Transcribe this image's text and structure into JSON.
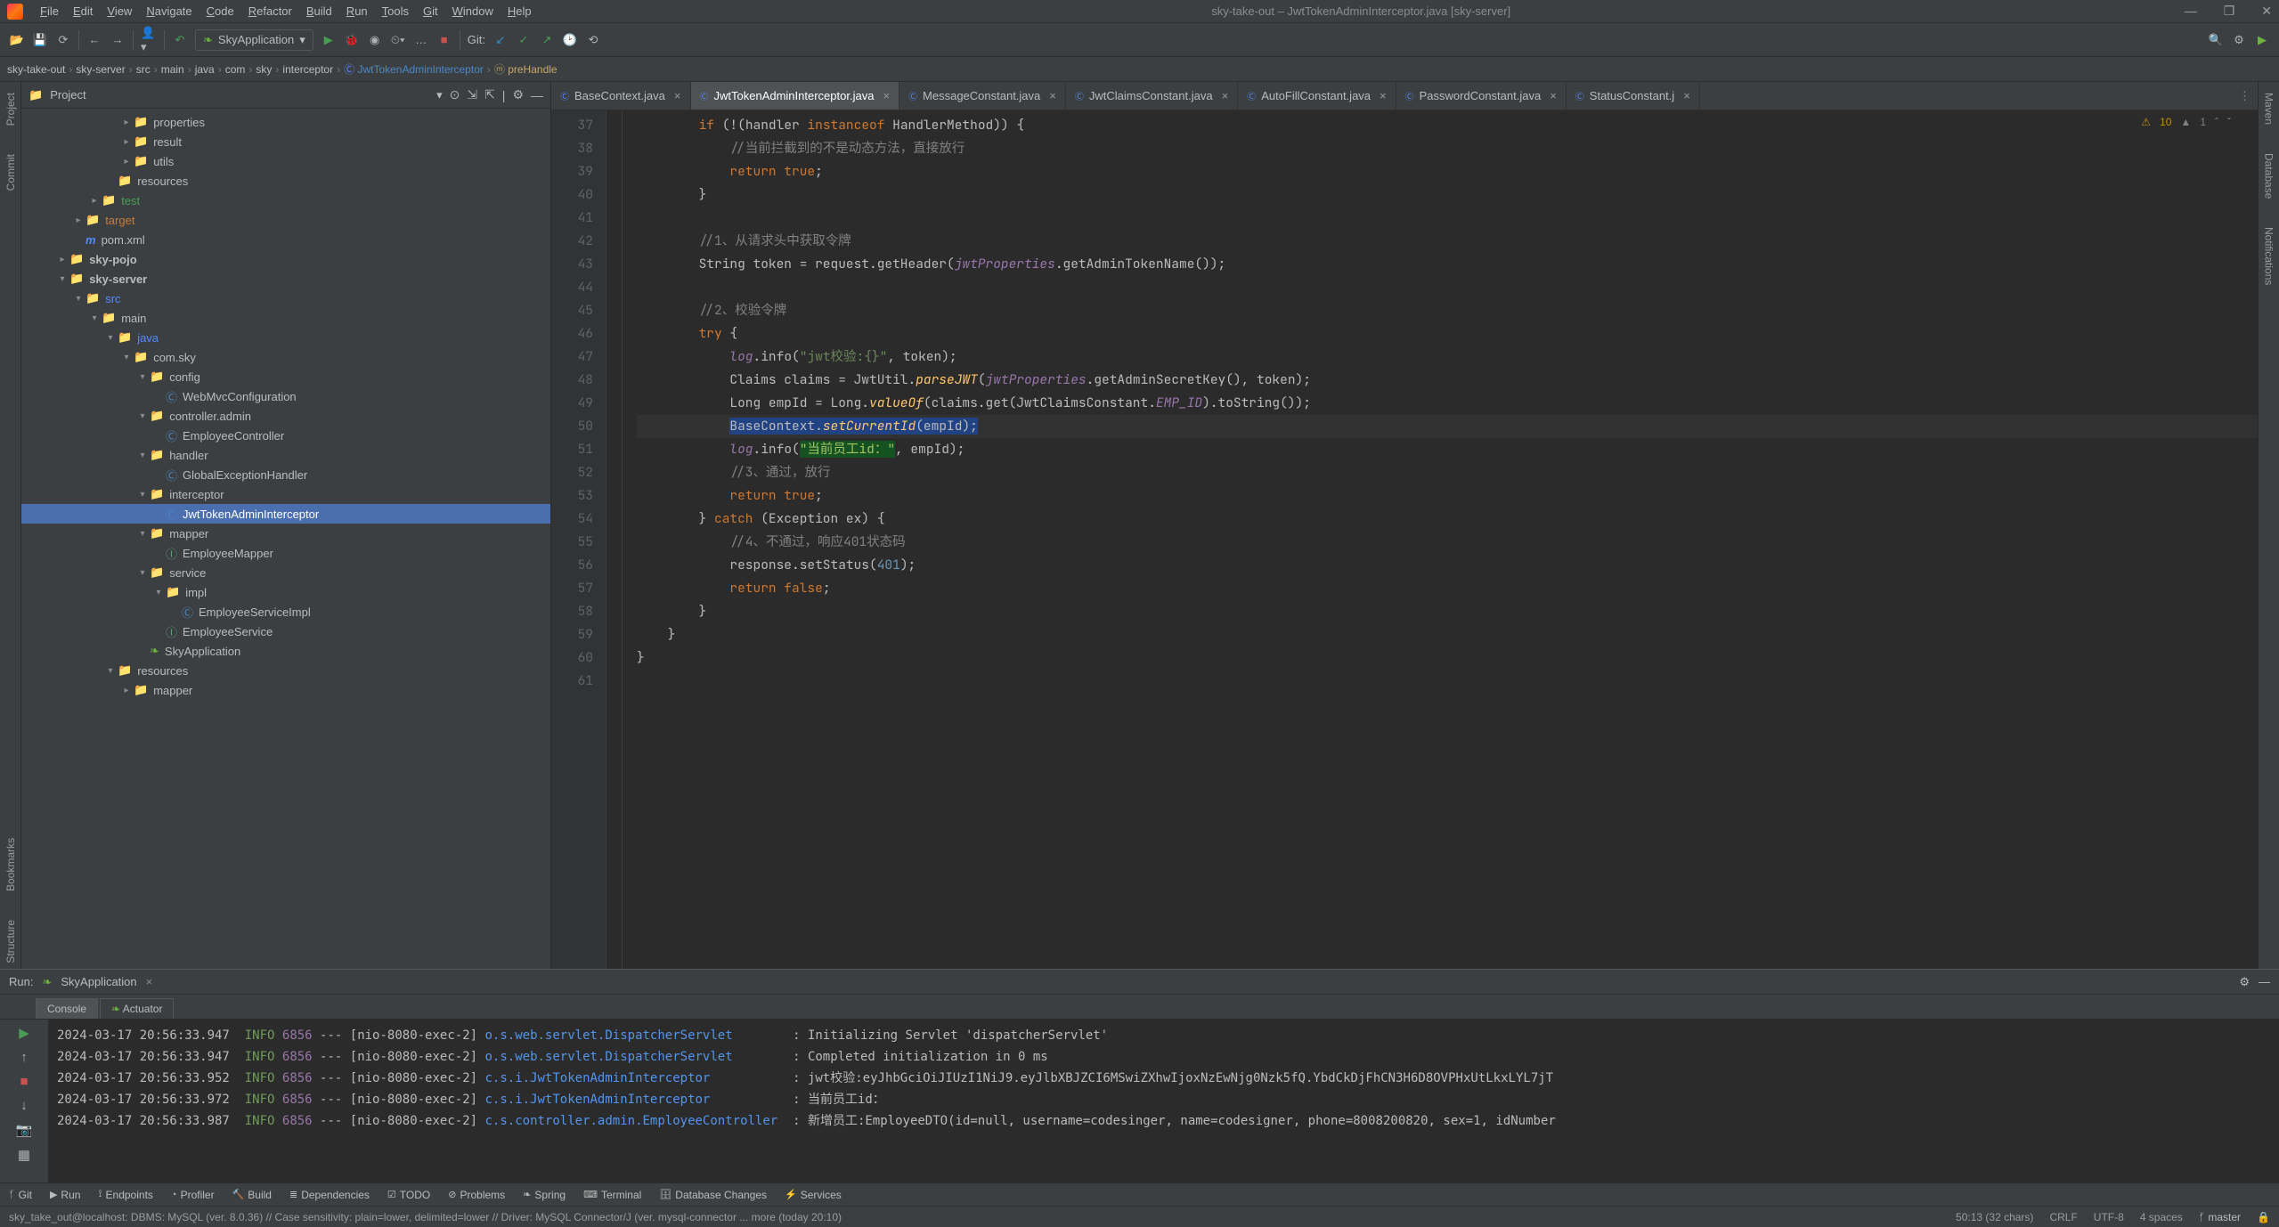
{
  "window": {
    "title": "sky-take-out – JwtTokenAdminInterceptor.java [sky-server]"
  },
  "menu": [
    "File",
    "Edit",
    "View",
    "Navigate",
    "Code",
    "Refactor",
    "Build",
    "Run",
    "Tools",
    "Git",
    "Window",
    "Help"
  ],
  "toolbar": {
    "runconfig": "SkyApplication",
    "git_label": "Git:"
  },
  "breadcrumbs": [
    {
      "t": "sky-take-out",
      "k": "plain"
    },
    {
      "t": "sky-server",
      "k": "plain"
    },
    {
      "t": "src",
      "k": "plain"
    },
    {
      "t": "main",
      "k": "plain"
    },
    {
      "t": "java",
      "k": "plain"
    },
    {
      "t": "com",
      "k": "plain"
    },
    {
      "t": "sky",
      "k": "plain"
    },
    {
      "t": "interceptor",
      "k": "plain"
    },
    {
      "t": "JwtTokenAdminInterceptor",
      "k": "cls"
    },
    {
      "t": "preHandle",
      "k": "meth"
    }
  ],
  "project": {
    "title": "Project",
    "tree": [
      {
        "d": 5,
        "a": ">",
        "i": "folder",
        "n": "properties"
      },
      {
        "d": 5,
        "a": ">",
        "i": "folder",
        "n": "result"
      },
      {
        "d": 5,
        "a": ">",
        "i": "folder",
        "n": "utils"
      },
      {
        "d": 4,
        "a": "",
        "i": "folder",
        "n": "resources"
      },
      {
        "d": 3,
        "a": ">",
        "i": "test",
        "n": "test",
        "cls": "test"
      },
      {
        "d": 2,
        "a": ">",
        "i": "target",
        "n": "target",
        "cls": "target"
      },
      {
        "d": 2,
        "a": "",
        "i": "maven",
        "n": "pom.xml"
      },
      {
        "d": 1,
        "a": ">",
        "i": "folder",
        "n": "sky-pojo",
        "cls": "module"
      },
      {
        "d": 1,
        "a": "v",
        "i": "folder",
        "n": "sky-server",
        "cls": "module"
      },
      {
        "d": 2,
        "a": "v",
        "i": "java",
        "n": "src",
        "cls": "java"
      },
      {
        "d": 3,
        "a": "v",
        "i": "folder",
        "n": "main"
      },
      {
        "d": 4,
        "a": "v",
        "i": "java",
        "n": "java",
        "cls": "java"
      },
      {
        "d": 5,
        "a": "v",
        "i": "folder",
        "n": "com.sky"
      },
      {
        "d": 6,
        "a": "v",
        "i": "folder",
        "n": "config"
      },
      {
        "d": 7,
        "a": "",
        "i": "class",
        "n": "WebMvcConfiguration"
      },
      {
        "d": 6,
        "a": "v",
        "i": "folder",
        "n": "controller.admin"
      },
      {
        "d": 7,
        "a": "",
        "i": "class",
        "n": "EmployeeController"
      },
      {
        "d": 6,
        "a": "v",
        "i": "folder",
        "n": "handler"
      },
      {
        "d": 7,
        "a": "",
        "i": "class",
        "n": "GlobalExceptionHandler"
      },
      {
        "d": 6,
        "a": "v",
        "i": "folder",
        "n": "interceptor"
      },
      {
        "d": 7,
        "a": "",
        "i": "class",
        "n": "JwtTokenAdminInterceptor",
        "sel": true
      },
      {
        "d": 6,
        "a": "v",
        "i": "folder",
        "n": "mapper"
      },
      {
        "d": 7,
        "a": "",
        "i": "int",
        "n": "EmployeeMapper"
      },
      {
        "d": 6,
        "a": "v",
        "i": "folder",
        "n": "service"
      },
      {
        "d": 7,
        "a": "v",
        "i": "folder",
        "n": "impl"
      },
      {
        "d": 8,
        "a": "",
        "i": "class",
        "n": "EmployeeServiceImpl"
      },
      {
        "d": 7,
        "a": "",
        "i": "int",
        "n": "EmployeeService"
      },
      {
        "d": 6,
        "a": "",
        "i": "spring",
        "n": "SkyApplication"
      },
      {
        "d": 4,
        "a": "v",
        "i": "folder",
        "n": "resources"
      },
      {
        "d": 5,
        "a": ">",
        "i": "folder",
        "n": "mapper"
      }
    ]
  },
  "tabs": [
    {
      "n": "BaseContext.java",
      "active": false
    },
    {
      "n": "JwtTokenAdminInterceptor.java",
      "active": true
    },
    {
      "n": "MessageConstant.java",
      "active": false
    },
    {
      "n": "JwtClaimsConstant.java",
      "active": false
    },
    {
      "n": "AutoFillConstant.java",
      "active": false
    },
    {
      "n": "PasswordConstant.java",
      "active": false
    },
    {
      "n": "StatusConstant.j",
      "active": false
    }
  ],
  "warnings": {
    "w": "10",
    "t": "1"
  },
  "code": {
    "start": 37,
    "lines": [
      {
        "n": 37,
        "html": "        <span class='kw'>if</span> (!(handler <span class='kw'>instanceof</span> HandlerMethod)) {"
      },
      {
        "n": 38,
        "html": "            <span class='cmt'>//当前拦截到的不是动态方法，直接放行</span>"
      },
      {
        "n": 39,
        "html": "            <span class='kw'>return true</span>;"
      },
      {
        "n": 40,
        "html": "        }"
      },
      {
        "n": 41,
        "html": ""
      },
      {
        "n": 42,
        "html": "        <span class='cmt'>//1、从请求头中获取令牌</span>"
      },
      {
        "n": 43,
        "html": "        String token = request.getHeader(<span class='prop'>jwtProperties</span>.getAdminTokenName());"
      },
      {
        "n": 44,
        "html": ""
      },
      {
        "n": 45,
        "html": "        <span class='cmt'>//2、校验令牌</span>"
      },
      {
        "n": 46,
        "html": "        <span class='kw'>try</span> {"
      },
      {
        "n": 47,
        "html": "            <span class='prop'>log</span>.info(<span class='str'>\"jwt校验:{}\"</span>, token);"
      },
      {
        "n": 48,
        "html": "            Claims claims = JwtUtil.<span class='simplecall'>parseJWT</span>(<span class='prop'>jwtProperties</span>.getAdminSecretKey(), token);"
      },
      {
        "n": 49,
        "html": "            Long empId = Long.<span class='simplecall'>valueOf</span>(claims.get(JwtClaimsConstant.<span class='const'>EMP_ID</span>).toString());"
      },
      {
        "n": 50,
        "cur": true,
        "html": "            <span class='sel'>BaseContext.<span class='simplecall'>setCurrentId</span>(empId);</span>"
      },
      {
        "n": 51,
        "html": "            <span class='prop'>log</span>.info(<span class='strh'>\"当前员工id：\"</span>, empId);"
      },
      {
        "n": 52,
        "html": "            <span class='cmt'>//3、通过，放行</span>"
      },
      {
        "n": 53,
        "html": "            <span class='kw'>return true</span>;"
      },
      {
        "n": 54,
        "html": "        } <span class='kw'>catch</span> (Exception ex) {"
      },
      {
        "n": 55,
        "html": "            <span class='cmt'>//4、不通过，响应401状态码</span>"
      },
      {
        "n": 56,
        "html": "            response.setStatus(<span class='num'>401</span>);"
      },
      {
        "n": 57,
        "html": "            <span class='kw'>return false</span>;"
      },
      {
        "n": 58,
        "html": "        }"
      },
      {
        "n": 59,
        "html": "    }"
      },
      {
        "n": 60,
        "html": "}"
      },
      {
        "n": 61,
        "html": ""
      }
    ]
  },
  "run": {
    "title": "Run:",
    "config": "SkyApplication",
    "tabs": [
      "Console",
      "Actuator"
    ],
    "logs": [
      {
        "ts": "2024-03-17 20:56:33.947",
        "lvl": "INFO",
        "pid": "6856",
        "th": "[nio-8080-exec-2]",
        "cls": "o.s.web.servlet.DispatcherServlet",
        "msg": "Initializing Servlet 'dispatcherServlet'"
      },
      {
        "ts": "2024-03-17 20:56:33.947",
        "lvl": "INFO",
        "pid": "6856",
        "th": "[nio-8080-exec-2]",
        "cls": "o.s.web.servlet.DispatcherServlet",
        "msg": "Completed initialization in 0 ms"
      },
      {
        "ts": "2024-03-17 20:56:33.952",
        "lvl": "INFO",
        "pid": "6856",
        "th": "[nio-8080-exec-2]",
        "cls": "c.s.i.JwtTokenAdminInterceptor",
        "msg": "jwt校验:eyJhbGciOiJIUzI1NiJ9.eyJlbXBJZCI6MSwiZXhwIjoxNzEwNjg0Nzk5fQ.YbdCkDjFhCN3H6D8OVPHxUtLkxLYL7jT"
      },
      {
        "ts": "2024-03-17 20:56:33.972",
        "lvl": "INFO",
        "pid": "6856",
        "th": "[nio-8080-exec-2]",
        "cls": "c.s.i.JwtTokenAdminInterceptor",
        "msg": "当前员工id："
      },
      {
        "ts": "2024-03-17 20:56:33.987",
        "lvl": "INFO",
        "pid": "6856",
        "th": "[nio-8080-exec-2]",
        "cls": "c.s.controller.admin.EmployeeController",
        "msg": "新增员工:EmployeeDTO(id=null, username=codesinger, name=codesigner, phone=8008200820, sex=1, idNumber"
      }
    ]
  },
  "bottombar": [
    "Git",
    "Run",
    "Endpoints",
    "Profiler",
    "Build",
    "Dependencies",
    "TODO",
    "Problems",
    "Spring",
    "Terminal",
    "Database Changes",
    "Services"
  ],
  "status": {
    "db": "sky_take_out@localhost: DBMS: MySQL (ver. 8.0.36) // Case sensitivity: plain=lower, delimited=lower // Driver: MySQL Connector/J (ver. mysql-connector ... more (today 20:10)",
    "pos": "50:13 (32 chars)",
    "eol": "CRLF",
    "enc": "UTF-8",
    "indent": "4 spaces",
    "branch": "master"
  },
  "righttabs": [
    "Maven",
    "Database",
    "Notifications"
  ],
  "lefttabs": [
    "Project",
    "Commit",
    "Bookmarks",
    "Structure"
  ]
}
